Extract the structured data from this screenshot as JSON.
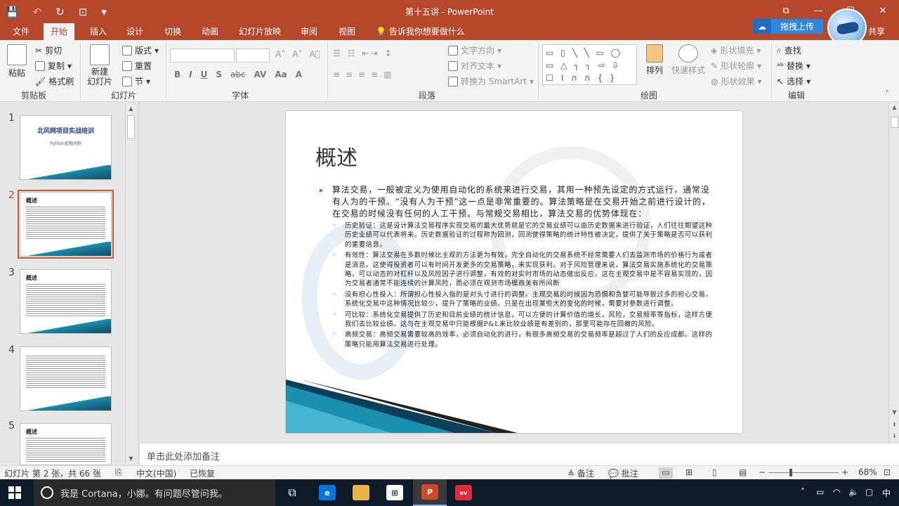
{
  "window": {
    "title": "第十五讲 - PowerPoint",
    "controls": [
      "⧉",
      "—",
      "☐",
      "✕"
    ]
  },
  "qat": {
    "save": "💾",
    "undo": "↶",
    "redo": "↻",
    "present": "⊡",
    "more": "▾"
  },
  "upload": {
    "label": "拖拽上传",
    "share_label": "共享"
  },
  "tabs": [
    {
      "label": "文件"
    },
    {
      "label": "开始"
    },
    {
      "label": "插入"
    },
    {
      "label": "设计"
    },
    {
      "label": "切换"
    },
    {
      "label": "动画"
    },
    {
      "label": "幻灯片放映"
    },
    {
      "label": "审阅"
    },
    {
      "label": "视图"
    }
  ],
  "tell_me": "告诉我你想要做什么",
  "ribbon": {
    "clipboard": {
      "paste": "粘贴",
      "cut": "剪切",
      "copy": "复制",
      "format_painter": "格式刷",
      "group": "剪贴板"
    },
    "slides": {
      "new_slide": "新建",
      "new_slide2": "幻灯片",
      "layout": "版式",
      "reset": "重置",
      "section": "节",
      "group": "幻灯片"
    },
    "font": {
      "group": "字体",
      "grow": "A˄",
      "shrink": "A˅",
      "clear": "A⃠",
      "bold": "B",
      "italic": "I",
      "underline": "U",
      "shadow": "S",
      "strike": "abc",
      "spacing": "AV",
      "case": "Aa",
      "color": "A"
    },
    "paragraph": {
      "group": "段落",
      "text_direction": "文字方向",
      "align_text": "对齐文本",
      "smartart": "转换为 SmartArt"
    },
    "drawing": {
      "group": "绘图",
      "arrange": "排列",
      "quick_styles": "快速样式",
      "shape_fill": "形状填充",
      "shape_outline": "形状轮廓",
      "shape_effects": "形状效果",
      "shapes_row1": "▭ ▯ ╲ ╲ ▭ ◯",
      "shapes_row2": "▭ △ ┐ ┐ ⇨ ⇩",
      "shapes_row3": "☐ ⌇ ∩ ∩ { }"
    },
    "editing": {
      "group": "编辑",
      "find": "查找",
      "replace": "替换",
      "select": "选择"
    }
  },
  "thumbnails": [
    {
      "num": "1",
      "title": "北风网项目实战培训",
      "subtitle": "Python金融分析"
    },
    {
      "num": "2",
      "title": "概述"
    },
    {
      "num": "3",
      "title": "概述"
    },
    {
      "num": "4",
      "title": ""
    },
    {
      "num": "5",
      "title": "概述"
    }
  ],
  "slide": {
    "title": "概述",
    "intro": "算法交易，一般被定义为使用自动化的系统来进行交易，其用一种预先设定的方式运行，通常没有人为的干预。“没有人为干预”这一点是非常重要的。算法策略是在交易开始之前进行设计的，在交易的时候没有任何的人工干预。与常规交易相比，算法交易的优势体现在：",
    "points": [
      "历史验证：这是设计算法交易程序实现交易的最大优势就是它的交易业绩可以由历史数据来进行验证，人们往往期望这种历史业绩可以代表将来。历史数据验证的过程称为回测，回测使得策略的统计特性被决定，提供了关于策略是否可以获利的重要信息。",
      "有效性：算法交易在多数时候比主观的方法更为有效，完全自动化的交易系统不经常需要人们去监测市场的价格行为或者是消息。这使得投资者可以有时间开发更多的交易策略，来实现获利。对于风险管理来说，算法交易实施系统化的交易策略，可以动态的对杠杆以及风险因子进行调整，有效的对实时市场的动态做出反应。这在主观交易中是不容易实现的，因为交易者通常不能连续的计算风险，而必须在观测市场模商关有所间断",
      "没有担心性投入：所谓担心性投入指的是对头寸进行的调整。主观交易的时候因为恐惧和贪婪可能导致过多的担心交易，系统化交易中这种情况比较少，提升了策略的业绩。只是在出现某些大的变化的时候，需要对参数进行调整。",
      "可比较：系统化交易提供了历史和目前业绩的统计信息，可以方便的计算价值的增长，风险，交易频率等指标，这样方便我们去比较业绩。这与在主观交易中只能根据P&L来比较业绩是有差别的，那里可能存在回撤的风险。",
      "高频交易：高频交易需要较高的效率，必须自动化的进行，有很多高频交易的交易频率是超过了人们的反应成都。这样的策略只能用算法交易进行处理。"
    ]
  },
  "notes": {
    "placeholder": "单击此处添加备注"
  },
  "status": {
    "slide_info": "幻灯片 第 2 张，共 66 张",
    "language": "中文(中国)",
    "recovered": "已恢复",
    "notes": "备注",
    "comments": "批注",
    "zoom": "68%"
  },
  "taskbar": {
    "cortana": "我是 Cortana，小娜。有问题尽管问我。",
    "ime": "中"
  },
  "colors": {
    "accent": "#b7472a",
    "slide_blue": "#1f8fb7"
  }
}
